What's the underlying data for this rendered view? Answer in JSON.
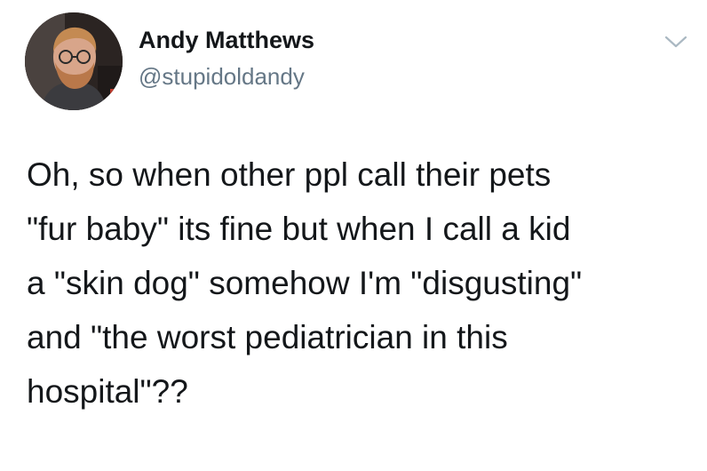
{
  "tweet": {
    "author": {
      "display_name": "Andy Matthews",
      "handle": "@stupidoldandy",
      "avatar_icon": "profile-photo"
    },
    "menu_icon": "chevron-down-icon",
    "text_lines": [
      "Oh, so when other ppl call their pets",
      "\"fur baby\" its fine but when I call a kid",
      "a \"skin dog\" somehow I'm \"disgusting\"",
      "and \"the worst pediatrician in this",
      "hospital\"??"
    ]
  },
  "colors": {
    "text_primary": "#14171a",
    "text_secondary": "#657786",
    "chevron": "#aab8c2",
    "background": "#ffffff"
  }
}
